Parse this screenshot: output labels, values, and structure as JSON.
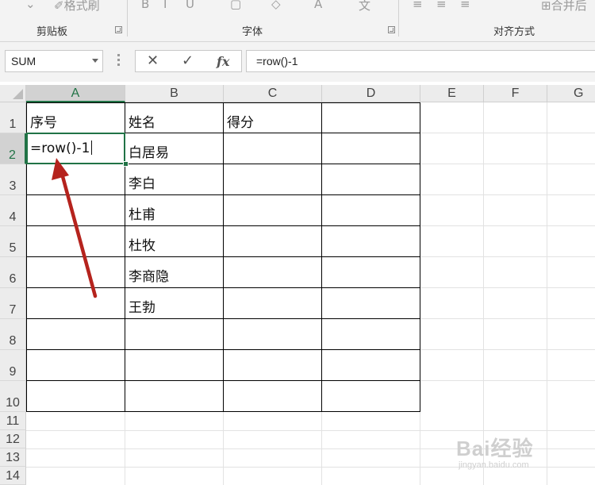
{
  "ribbon": {
    "format_painter_label": "格式刷",
    "groups": [
      {
        "label": "剪贴板"
      },
      {
        "label": "字体"
      },
      {
        "label": "对齐方式"
      }
    ],
    "merge_label": "合并后"
  },
  "formula_bar": {
    "name_box": "SUM",
    "cancel_glyph": "✕",
    "enter_glyph": "✓",
    "fx_label": "fx",
    "formula": "=row()-1"
  },
  "columns": [
    "A",
    "B",
    "C",
    "D",
    "E",
    "F",
    "G"
  ],
  "rows": [
    "1",
    "2",
    "3",
    "4",
    "5",
    "6",
    "7",
    "8",
    "9",
    "10",
    "11",
    "12",
    "13",
    "14"
  ],
  "table": {
    "headers": [
      "序号",
      "姓名",
      "得分"
    ],
    "a2_editing": "=row()-1",
    "names": [
      "白居易",
      "李白",
      "杜甫",
      "杜牧",
      "李商隐",
      "王勃"
    ]
  },
  "annotation": {
    "arrow_color": "#b5231d"
  },
  "colors": {
    "accent": "#217346"
  },
  "watermark": {
    "main": "Bai经验",
    "sub": "jingyan.baidu.com"
  }
}
